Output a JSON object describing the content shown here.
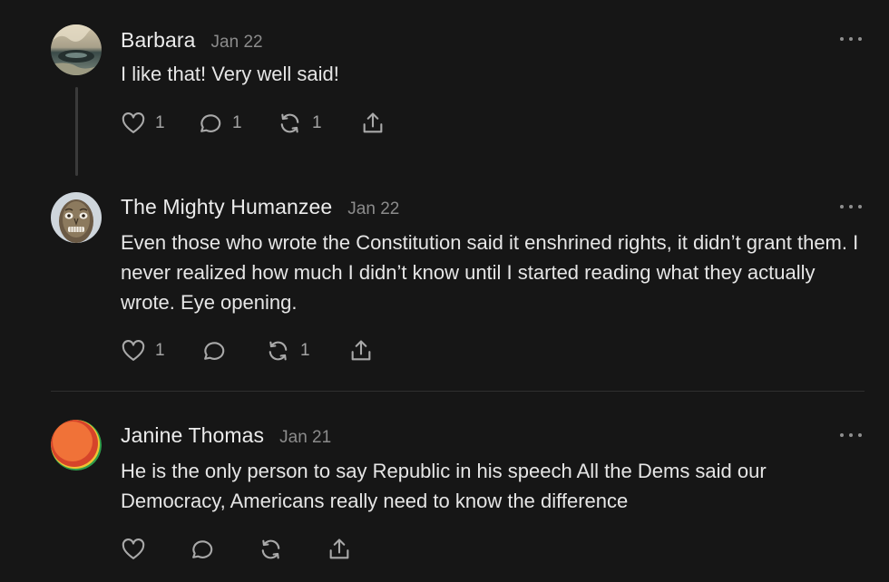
{
  "comments": [
    {
      "author": "Barbara",
      "date": "Jan 22",
      "text": "I like that! Very well said!",
      "likes": "1",
      "replies": "1",
      "restacks": "1",
      "avatar_icon": "landscape-photo-avatar"
    },
    {
      "author": "The Mighty Humanzee",
      "date": "Jan 22",
      "text": "Even those who wrote the Constitution said it enshrined rights, it didn’t grant them. I never realized how much I didn’t know until I started reading what they actually wrote. Eye opening.",
      "likes": "1",
      "replies": "",
      "restacks": "1",
      "avatar_icon": "carved-mask-avatar"
    },
    {
      "author": "Janine Thomas",
      "date": "Jan 21",
      "text": "He is the only person to say Republic in his speech All the Dems said our Democracy, Americans really need to know the difference",
      "likes": "",
      "replies": "",
      "restacks": "",
      "avatar_icon": "orange-gradient-avatar"
    }
  ],
  "icons": {
    "like": "heart-icon",
    "reply": "speech-bubble-icon",
    "restack": "restack-arrows-icon",
    "share": "share-upload-icon",
    "more": "more-dots-icon"
  },
  "colors": {
    "background": "#161616",
    "text": "#e6e6e6",
    "muted": "#8b8b8b",
    "icon": "#a9a9a9"
  }
}
